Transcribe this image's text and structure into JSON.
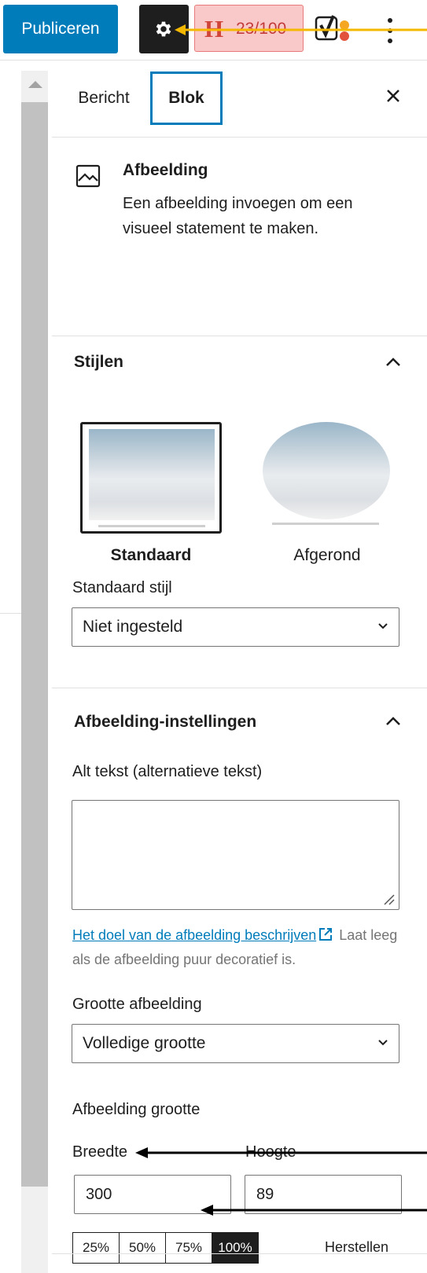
{
  "toolbar": {
    "publish_label": "Publiceren",
    "seo_score": "23/100",
    "seo_letter": "H"
  },
  "tabs": [
    {
      "label": "Bericht"
    },
    {
      "label": "Blok"
    }
  ],
  "block": {
    "title": "Afbeelding",
    "description": "Een afbeelding invoegen om een visueel statement te maken."
  },
  "styles": {
    "title": "Stijlen",
    "options": [
      {
        "label": "Standaard",
        "selected": true
      },
      {
        "label": "Afgerond",
        "selected": false
      }
    ],
    "default_style_label": "Standaard stijl",
    "default_style_value": "Niet ingesteld"
  },
  "image_settings": {
    "title": "Afbeelding-instellingen",
    "alt_label": "Alt tekst (alternatieve tekst)",
    "alt_value": "",
    "help_link": "Het doel van de afbeelding beschrijven",
    "help_text": "Laat leeg als de afbeelding puur decoratief is.",
    "size_label": "Grootte afbeelding",
    "size_value": "Volledige grootte",
    "dimensions_label": "Afbeelding grootte",
    "width_label": "Breedte",
    "width_value": "300",
    "height_label": "Hoogte",
    "height_value": "89",
    "percent_options": [
      "25%",
      "50%",
      "75%",
      "100%"
    ],
    "reset_label": "Herstellen"
  },
  "colors": {
    "accent": "#007cba",
    "seo_bad": "#d0453a",
    "annotation_arrow": "#f5b800"
  }
}
